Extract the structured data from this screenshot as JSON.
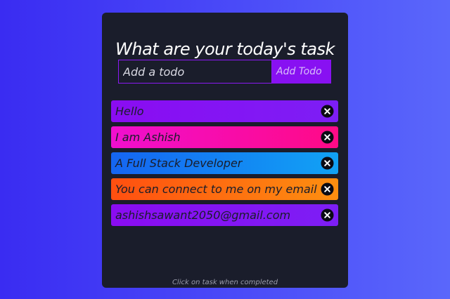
{
  "app": {
    "title": "What are your today's task"
  },
  "form": {
    "input_value": "",
    "input_placeholder": "Add a todo",
    "add_label": "Add Todo"
  },
  "todos": [
    {
      "text": "Hello",
      "gradient": [
        "#8a0cf2",
        "#7d1ef5"
      ]
    },
    {
      "text": "I am Ashish",
      "gradient": [
        "#f00fcf",
        "#ff0a86"
      ]
    },
    {
      "text": "A Full Stack Developer",
      "gradient": [
        "#1565f2",
        "#11a2f4"
      ]
    },
    {
      "text": "You can connect to me on my email",
      "gradient": [
        "#ff4f10",
        "#fd8f10"
      ]
    },
    {
      "text": "ashishsawant2050@gmail.com",
      "gradient": [
        "#8a0cf2",
        "#7d1ef5"
      ]
    }
  ],
  "remove_icon": "close-circle-icon",
  "footer": {
    "hint": "Click on task when completed"
  },
  "colors": {
    "card_bg": "#1a1d2b",
    "accent": "#8811f2"
  }
}
